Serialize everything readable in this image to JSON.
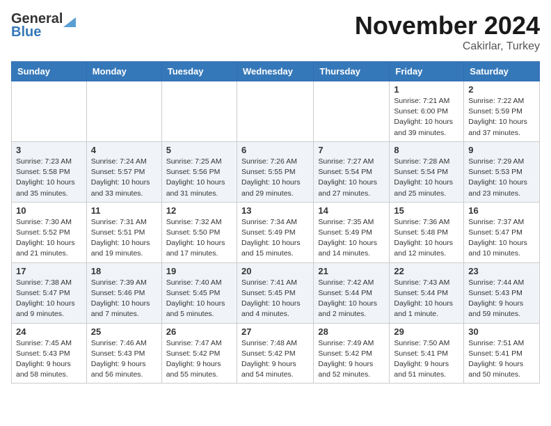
{
  "header": {
    "logo_general": "General",
    "logo_blue": "Blue",
    "title": "November 2024",
    "location": "Cakirlar, Turkey"
  },
  "days_of_week": [
    "Sunday",
    "Monday",
    "Tuesday",
    "Wednesday",
    "Thursday",
    "Friday",
    "Saturday"
  ],
  "weeks": [
    [
      {
        "day": "",
        "info": ""
      },
      {
        "day": "",
        "info": ""
      },
      {
        "day": "",
        "info": ""
      },
      {
        "day": "",
        "info": ""
      },
      {
        "day": "",
        "info": ""
      },
      {
        "day": "1",
        "info": "Sunrise: 7:21 AM\nSunset: 6:00 PM\nDaylight: 10 hours\nand 39 minutes."
      },
      {
        "day": "2",
        "info": "Sunrise: 7:22 AM\nSunset: 5:59 PM\nDaylight: 10 hours\nand 37 minutes."
      }
    ],
    [
      {
        "day": "3",
        "info": "Sunrise: 7:23 AM\nSunset: 5:58 PM\nDaylight: 10 hours\nand 35 minutes."
      },
      {
        "day": "4",
        "info": "Sunrise: 7:24 AM\nSunset: 5:57 PM\nDaylight: 10 hours\nand 33 minutes."
      },
      {
        "day": "5",
        "info": "Sunrise: 7:25 AM\nSunset: 5:56 PM\nDaylight: 10 hours\nand 31 minutes."
      },
      {
        "day": "6",
        "info": "Sunrise: 7:26 AM\nSunset: 5:55 PM\nDaylight: 10 hours\nand 29 minutes."
      },
      {
        "day": "7",
        "info": "Sunrise: 7:27 AM\nSunset: 5:54 PM\nDaylight: 10 hours\nand 27 minutes."
      },
      {
        "day": "8",
        "info": "Sunrise: 7:28 AM\nSunset: 5:54 PM\nDaylight: 10 hours\nand 25 minutes."
      },
      {
        "day": "9",
        "info": "Sunrise: 7:29 AM\nSunset: 5:53 PM\nDaylight: 10 hours\nand 23 minutes."
      }
    ],
    [
      {
        "day": "10",
        "info": "Sunrise: 7:30 AM\nSunset: 5:52 PM\nDaylight: 10 hours\nand 21 minutes."
      },
      {
        "day": "11",
        "info": "Sunrise: 7:31 AM\nSunset: 5:51 PM\nDaylight: 10 hours\nand 19 minutes."
      },
      {
        "day": "12",
        "info": "Sunrise: 7:32 AM\nSunset: 5:50 PM\nDaylight: 10 hours\nand 17 minutes."
      },
      {
        "day": "13",
        "info": "Sunrise: 7:34 AM\nSunset: 5:49 PM\nDaylight: 10 hours\nand 15 minutes."
      },
      {
        "day": "14",
        "info": "Sunrise: 7:35 AM\nSunset: 5:49 PM\nDaylight: 10 hours\nand 14 minutes."
      },
      {
        "day": "15",
        "info": "Sunrise: 7:36 AM\nSunset: 5:48 PM\nDaylight: 10 hours\nand 12 minutes."
      },
      {
        "day": "16",
        "info": "Sunrise: 7:37 AM\nSunset: 5:47 PM\nDaylight: 10 hours\nand 10 minutes."
      }
    ],
    [
      {
        "day": "17",
        "info": "Sunrise: 7:38 AM\nSunset: 5:47 PM\nDaylight: 10 hours\nand 9 minutes."
      },
      {
        "day": "18",
        "info": "Sunrise: 7:39 AM\nSunset: 5:46 PM\nDaylight: 10 hours\nand 7 minutes."
      },
      {
        "day": "19",
        "info": "Sunrise: 7:40 AM\nSunset: 5:45 PM\nDaylight: 10 hours\nand 5 minutes."
      },
      {
        "day": "20",
        "info": "Sunrise: 7:41 AM\nSunset: 5:45 PM\nDaylight: 10 hours\nand 4 minutes."
      },
      {
        "day": "21",
        "info": "Sunrise: 7:42 AM\nSunset: 5:44 PM\nDaylight: 10 hours\nand 2 minutes."
      },
      {
        "day": "22",
        "info": "Sunrise: 7:43 AM\nSunset: 5:44 PM\nDaylight: 10 hours\nand 1 minute."
      },
      {
        "day": "23",
        "info": "Sunrise: 7:44 AM\nSunset: 5:43 PM\nDaylight: 9 hours\nand 59 minutes."
      }
    ],
    [
      {
        "day": "24",
        "info": "Sunrise: 7:45 AM\nSunset: 5:43 PM\nDaylight: 9 hours\nand 58 minutes."
      },
      {
        "day": "25",
        "info": "Sunrise: 7:46 AM\nSunset: 5:43 PM\nDaylight: 9 hours\nand 56 minutes."
      },
      {
        "day": "26",
        "info": "Sunrise: 7:47 AM\nSunset: 5:42 PM\nDaylight: 9 hours\nand 55 minutes."
      },
      {
        "day": "27",
        "info": "Sunrise: 7:48 AM\nSunset: 5:42 PM\nDaylight: 9 hours\nand 54 minutes."
      },
      {
        "day": "28",
        "info": "Sunrise: 7:49 AM\nSunset: 5:42 PM\nDaylight: 9 hours\nand 52 minutes."
      },
      {
        "day": "29",
        "info": "Sunrise: 7:50 AM\nSunset: 5:41 PM\nDaylight: 9 hours\nand 51 minutes."
      },
      {
        "day": "30",
        "info": "Sunrise: 7:51 AM\nSunset: 5:41 PM\nDaylight: 9 hours\nand 50 minutes."
      }
    ]
  ]
}
